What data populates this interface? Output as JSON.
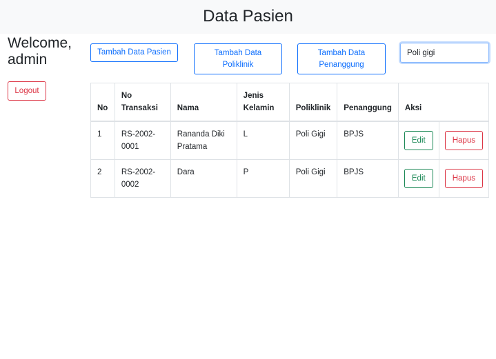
{
  "header": {
    "title": "Data Pasien"
  },
  "user": {
    "welcome": "Welcome, admin",
    "logout_label": "Logout"
  },
  "toolbar": {
    "add_patient_label": "Tambah Data Pasien",
    "add_clinic_label": "Tambah Data Poliklinik",
    "add_guarantor_label": "Tambah Data Penanggung"
  },
  "search": {
    "value": "Poli gigi",
    "placeholder": ""
  },
  "table": {
    "headers": [
      "No",
      "No Transaksi",
      "Nama",
      "Jenis Kelamin",
      "Poliklinik",
      "Penanggung",
      "Aksi"
    ],
    "rows": [
      {
        "no": "1",
        "transaksi": "RS-2002-0001",
        "nama": "Rananda Diki Pratama",
        "kelamin": "L",
        "poliklinik": "Poli Gigi",
        "penanggung": "BPJS"
      },
      {
        "no": "2",
        "transaksi": "RS-2002-0002",
        "nama": "Dara",
        "kelamin": "P",
        "poliklinik": "Poli Gigi",
        "penanggung": "BPJS"
      }
    ],
    "edit_label": "Edit",
    "delete_label": "Hapus"
  }
}
